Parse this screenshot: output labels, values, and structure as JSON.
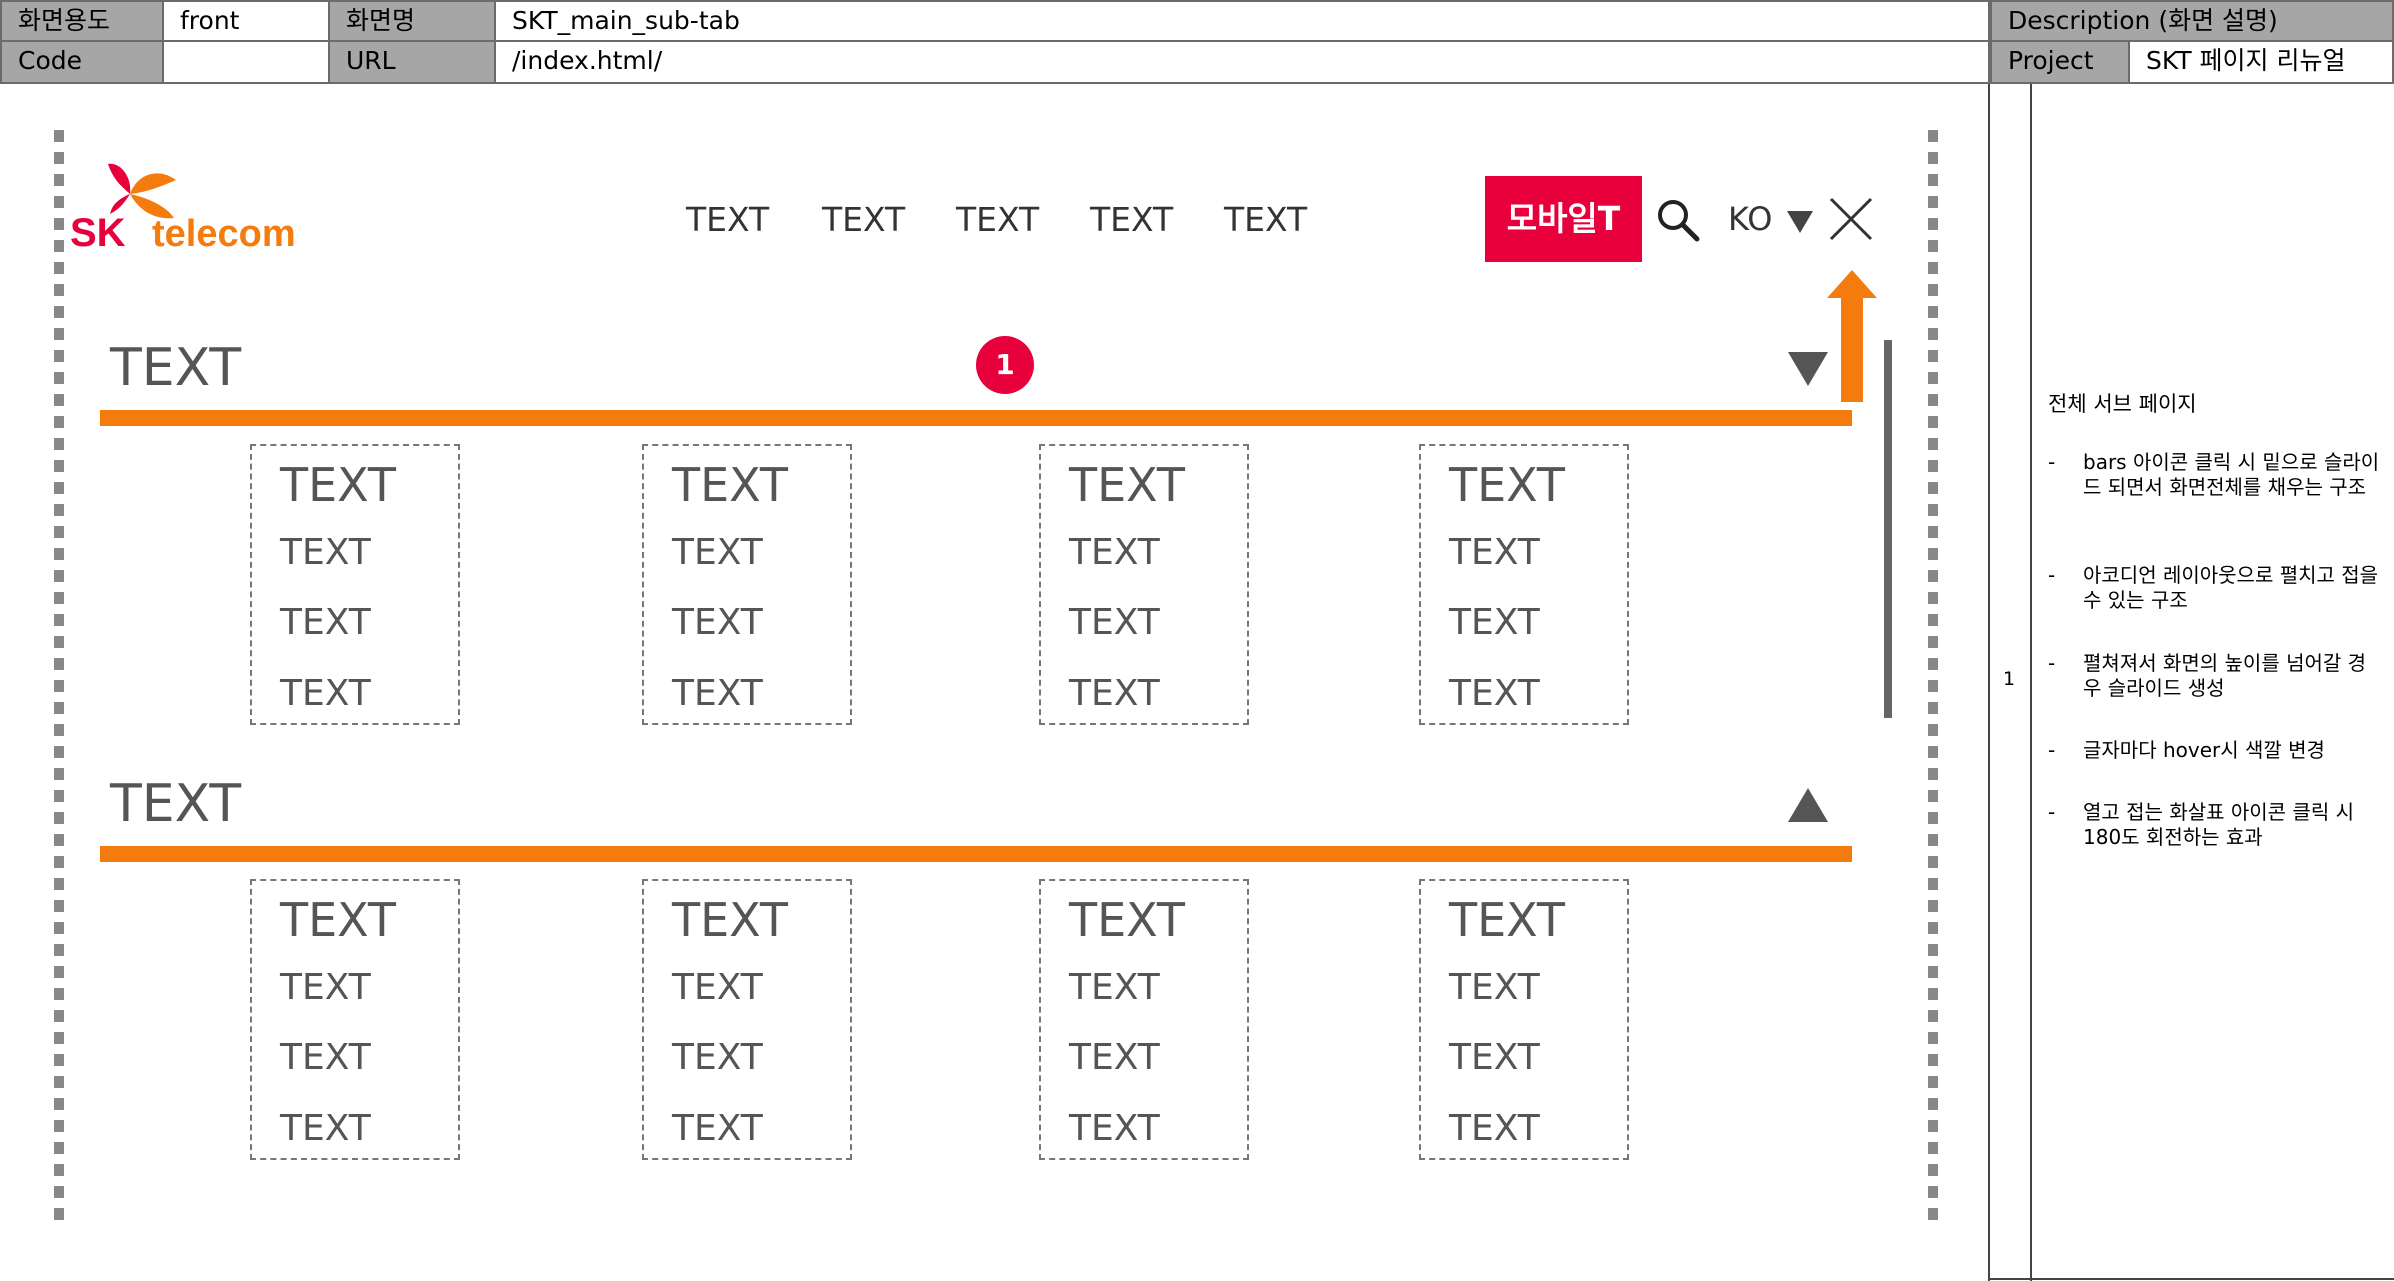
{
  "header": {
    "usage_label": "화면용도",
    "usage_value": "front",
    "screen_name_label": "화면명",
    "screen_name_value": "SKT_main_sub-tab",
    "code_label": "Code",
    "code_value": "",
    "url_label": "URL",
    "url_value": "/index.html/",
    "description_label": "Description (화면 설명)",
    "project_label": "Project",
    "project_value": "SKT 페이지 리뉴얼"
  },
  "description": {
    "number": "1",
    "title": "전체 서브 페이지",
    "items": [
      "bars 아이콘 클릭 시 밑으로 슬라이드 되면서 화면전체를 채우는 구조",
      "아코디언 레이아웃으로 펼치고 접을 수 있는 구조",
      "펼쳐져서 화면의 높이를 넘어갈 경우 슬라이드 생성",
      "글자마다 hover시 색깔 변경",
      "열고 접는 화살표 아이콘 클릭 시 180도 회전하는 효과"
    ],
    "dash": "-"
  },
  "mockup": {
    "logo": {
      "sk": "SK",
      "telecom": "telecom"
    },
    "nav": [
      "TEXT",
      "TEXT",
      "TEXT",
      "TEXT",
      "TEXT"
    ],
    "mobile_button": "모바일T",
    "lang": "KO",
    "badge": "1",
    "sections": [
      {
        "title": "TEXT",
        "toggle": "down",
        "cards": [
          {
            "heading": "TEXT",
            "items": [
              "TEXT",
              "TEXT",
              "TEXT"
            ]
          },
          {
            "heading": "TEXT",
            "items": [
              "TEXT",
              "TEXT",
              "TEXT"
            ]
          },
          {
            "heading": "TEXT",
            "items": [
              "TEXT",
              "TEXT",
              "TEXT"
            ]
          },
          {
            "heading": "TEXT",
            "items": [
              "TEXT",
              "TEXT",
              "TEXT"
            ]
          }
        ]
      },
      {
        "title": "TEXT",
        "toggle": "up",
        "cards": [
          {
            "heading": "TEXT",
            "items": [
              "TEXT",
              "TEXT",
              "TEXT"
            ]
          },
          {
            "heading": "TEXT",
            "items": [
              "TEXT",
              "TEXT",
              "TEXT"
            ]
          },
          {
            "heading": "TEXT",
            "items": [
              "TEXT",
              "TEXT",
              "TEXT"
            ]
          },
          {
            "heading": "TEXT",
            "items": [
              "TEXT",
              "TEXT",
              "TEXT"
            ]
          }
        ]
      }
    ]
  },
  "colors": {
    "accent_red": "#e8003d",
    "accent_orange": "#f47c0f",
    "table_gray": "#a6a6a6"
  }
}
